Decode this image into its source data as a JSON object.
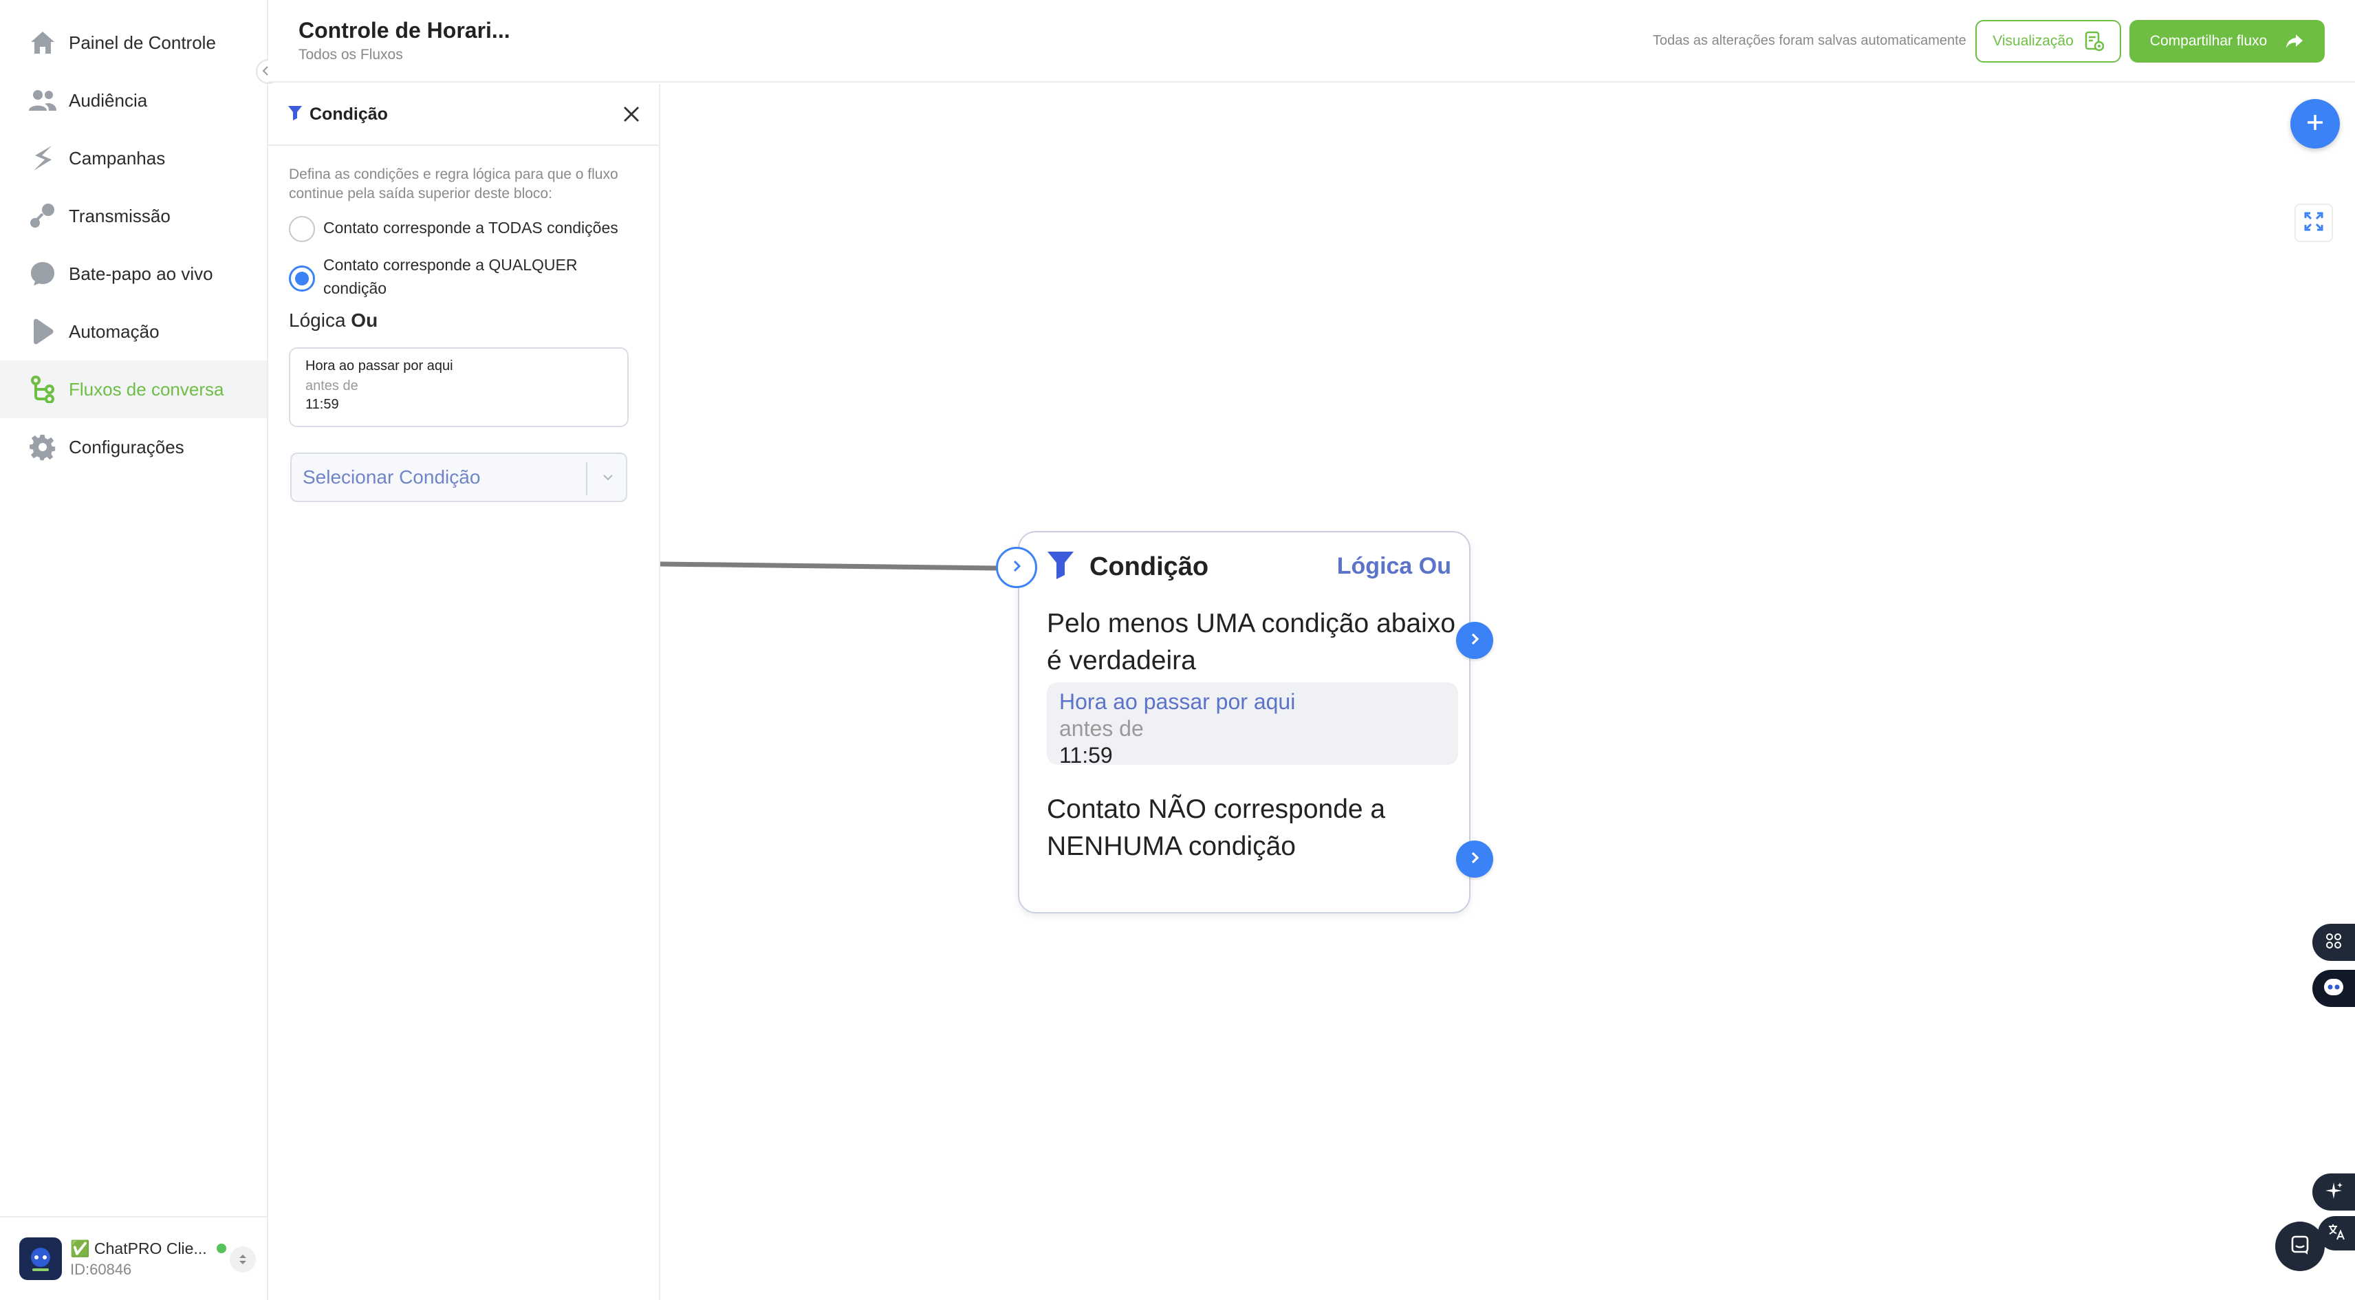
{
  "sidebar": {
    "items": [
      {
        "label": "Painel de Controle",
        "icon": "home-icon"
      },
      {
        "label": "Audiência",
        "icon": "users-icon"
      },
      {
        "label": "Campanhas",
        "icon": "campaign-icon"
      },
      {
        "label": "Transmissão",
        "icon": "broadcast-icon"
      },
      {
        "label": "Bate-papo ao vivo",
        "icon": "chat-icon"
      },
      {
        "label": "Automação",
        "icon": "automation-icon"
      },
      {
        "label": "Fluxos de conversa",
        "icon": "flow-icon"
      },
      {
        "label": "Configurações",
        "icon": "gear-icon"
      }
    ],
    "active_index": 6,
    "collapse_icon": "chevrons-left-icon",
    "account": {
      "name": "✅ ChatPRO Clie...",
      "id": "ID:60846",
      "status_color": "#55c25a"
    }
  },
  "header": {
    "title": "Controle de Horari...",
    "breadcrumb": "Todos os Fluxos",
    "saved_status": "Todas as alterações foram salvas automaticamente",
    "preview_label": "Visualização",
    "share_label": "Compartilhar fluxo"
  },
  "panel": {
    "title": "Condição",
    "description": "Defina as condições e regra lógica para que o fluxo continue pela saída superior deste bloco:",
    "option_all": "Contato corresponde a TODAS condições",
    "option_any": "Contato corresponde a QUALQUER condição",
    "selected_option": "any",
    "logic_label": "Lógica",
    "logic_value": "Ou",
    "condition": {
      "field": "Hora ao passar por aqui",
      "operator": "antes de",
      "value": "11:59"
    },
    "select_placeholder": "Selecionar Condição"
  },
  "node": {
    "title": "Condição",
    "logic": "Lógica Ou",
    "true_text": "Pelo menos UMA condição abaixo é verdadeira",
    "condition": {
      "field": "Hora ao passar por aqui",
      "operator": "antes de",
      "value": "11:59"
    },
    "false_text": "Contato NÃO corresponde a NENHUMA condição"
  },
  "colors": {
    "accent_green": "#6fbe44",
    "accent_blue": "#3b82f6",
    "logic_blue": "#5b73c8"
  }
}
